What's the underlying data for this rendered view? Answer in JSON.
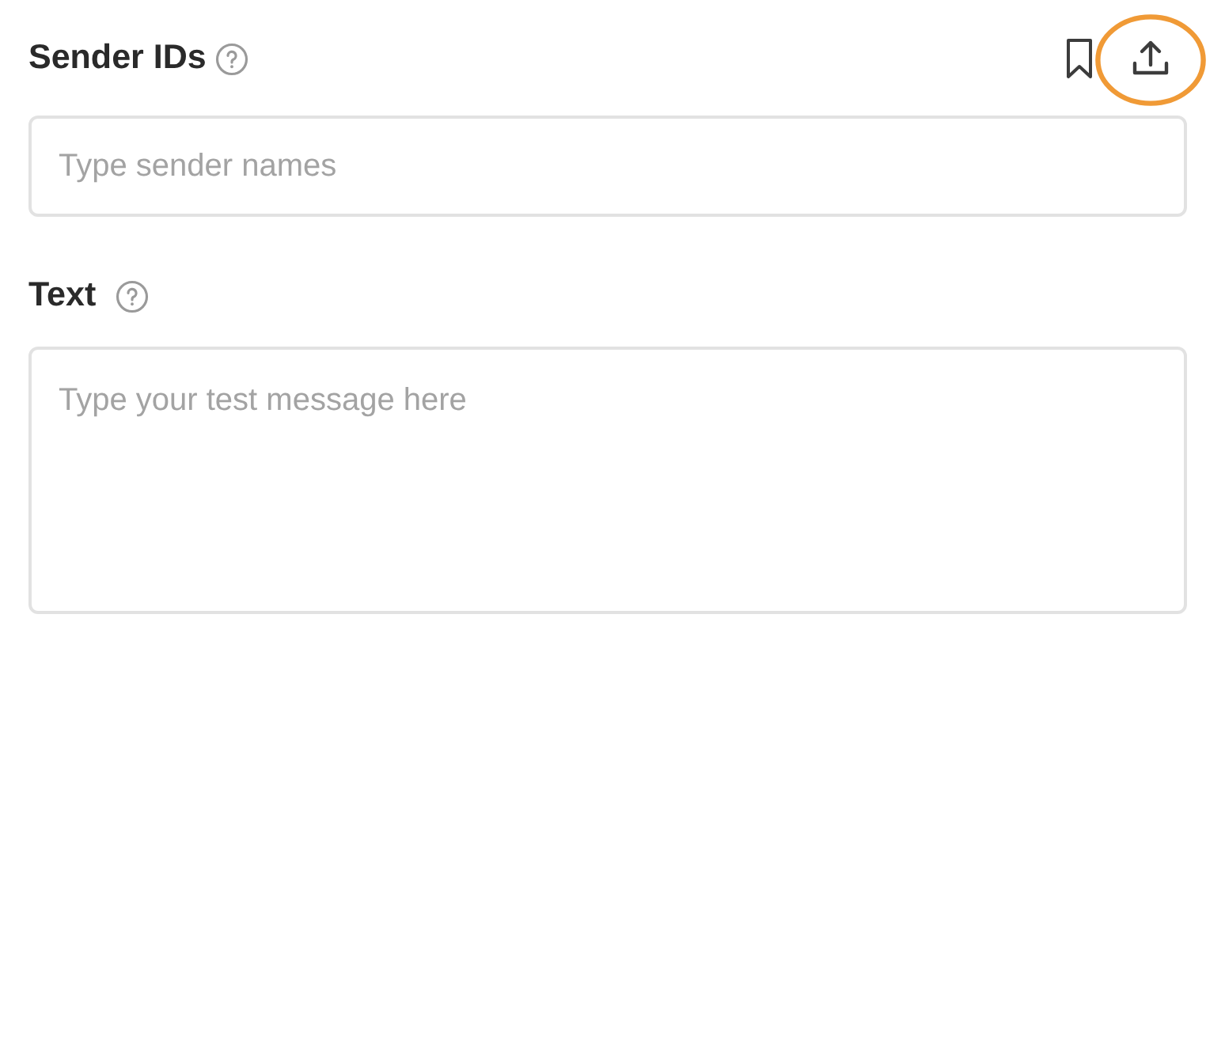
{
  "sender_ids": {
    "label": "Sender IDs",
    "actions": [
      {
        "kind": "bookmark",
        "highlighted": false
      },
      {
        "kind": "upload",
        "highlighted": true
      }
    ],
    "input": {
      "placeholder": "Type sender names"
    }
  },
  "text": {
    "label": "Text",
    "textarea": {
      "placeholder": "Type your test message here"
    }
  }
}
